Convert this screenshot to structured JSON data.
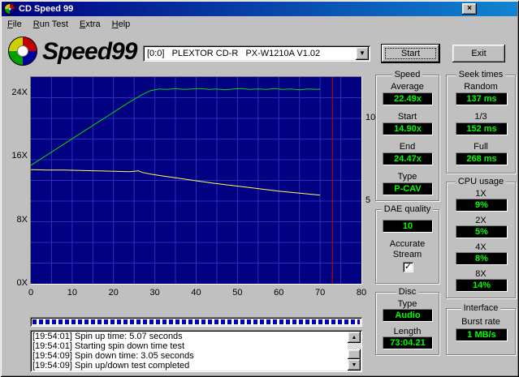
{
  "window": {
    "title": "CD Speed 99",
    "close_glyph": "×"
  },
  "menu": {
    "items": [
      "File",
      "Run Test",
      "Extra",
      "Help"
    ]
  },
  "toolbar": {
    "logo_text": "Speed99",
    "drive_selector": {
      "value": "[0:0]   PLEXTOR CD-R   PX-W1210A V1.02",
      "dropdown_glyph": "▼"
    },
    "start_button": "Start",
    "exit_button": "Exit"
  },
  "colors": {
    "chart_bg": "#000080",
    "chart_grid": "#2d2dc4",
    "end_marker": "#cc0000",
    "lcd_text": "#00ff00",
    "lcd_bg": "#000000",
    "titlebar_start": "#000080",
    "titlebar_end": "#1084d0"
  },
  "chart_data": {
    "type": "line",
    "x": {
      "lim": [
        0,
        80
      ],
      "ticks": [
        0,
        10,
        20,
        30,
        40,
        50,
        60,
        70,
        80
      ],
      "grid_step": 5
    },
    "left_axis": {
      "lim": [
        0,
        26
      ],
      "ticks": [
        {
          "v": 24,
          "label": "24X"
        },
        {
          "v": 16,
          "label": "16X"
        },
        {
          "v": 8,
          "label": "8X"
        },
        {
          "v": 0,
          "label": "0X"
        }
      ]
    },
    "right_axis": {
      "lim": [
        0,
        12.5
      ],
      "ticks": [
        {
          "v": 10,
          "label": "10"
        },
        {
          "v": 5,
          "label": "5"
        }
      ]
    },
    "grid_divisions_y": 10,
    "end_marker_x": 73,
    "series": [
      {
        "name": "read_speed",
        "color": "#00dc00",
        "points": [
          [
            0,
            14.9
          ],
          [
            3,
            15.9
          ],
          [
            6,
            16.9
          ],
          [
            9,
            17.9
          ],
          [
            12,
            18.9
          ],
          [
            15,
            19.9
          ],
          [
            18,
            20.9
          ],
          [
            21,
            21.9
          ],
          [
            24,
            22.9
          ],
          [
            27,
            23.8
          ],
          [
            29,
            24.3
          ],
          [
            31,
            24.5
          ],
          [
            33,
            24.45
          ],
          [
            35,
            24.55
          ],
          [
            37,
            24.45
          ],
          [
            39,
            24.5
          ],
          [
            41,
            24.55
          ],
          [
            43,
            24.45
          ],
          [
            45,
            24.5
          ],
          [
            47,
            24.4
          ],
          [
            49,
            24.5
          ],
          [
            51,
            24.55
          ],
          [
            53,
            24.45
          ],
          [
            55,
            24.5
          ],
          [
            57,
            24.45
          ],
          [
            59,
            24.55
          ],
          [
            61,
            24.45
          ],
          [
            63,
            24.5
          ],
          [
            65,
            24.4
          ],
          [
            67,
            24.5
          ],
          [
            69,
            24.45
          ],
          [
            70,
            24.47
          ]
        ]
      },
      {
        "name": "rotation_speed",
        "color": "#ffff55",
        "points": [
          [
            0,
            14.35
          ],
          [
            4,
            14.3
          ],
          [
            8,
            14.3
          ],
          [
            12,
            14.25
          ],
          [
            16,
            14.2
          ],
          [
            20,
            14.15
          ],
          [
            24,
            14.1
          ],
          [
            26,
            14.2
          ],
          [
            27,
            14.0
          ],
          [
            29,
            13.8
          ],
          [
            32,
            13.55
          ],
          [
            36,
            13.25
          ],
          [
            40,
            12.95
          ],
          [
            44,
            12.65
          ],
          [
            48,
            12.4
          ],
          [
            52,
            12.15
          ],
          [
            56,
            11.9
          ],
          [
            60,
            11.65
          ],
          [
            64,
            11.45
          ],
          [
            68,
            11.25
          ],
          [
            70,
            11.15
          ]
        ]
      }
    ]
  },
  "panels": {
    "speed": {
      "title": "Speed",
      "rows": [
        {
          "label": "Average",
          "value": "22.49x"
        },
        {
          "label": "Start",
          "value": "14.90x"
        },
        {
          "label": "End",
          "value": "24.47x"
        },
        {
          "label": "Type",
          "value": "P-CAV"
        }
      ]
    },
    "seek_times": {
      "title": "Seek times",
      "rows": [
        {
          "label": "Random",
          "value": "137 ms"
        },
        {
          "label": "1/3",
          "value": "152 ms"
        },
        {
          "label": "Full",
          "value": "268 ms"
        }
      ]
    },
    "cpu_usage": {
      "title": "CPU usage",
      "rows": [
        {
          "label": "1X",
          "value": "9%"
        },
        {
          "label": "2X",
          "value": "5%"
        },
        {
          "label": "4X",
          "value": "8%"
        },
        {
          "label": "8X",
          "value": "14%"
        }
      ]
    },
    "dae_quality": {
      "title": "DAE quality",
      "value": "10",
      "accurate_stream_label": "Accurate Stream",
      "checkbox_checked": true,
      "checkbox_glyph": "✓"
    },
    "disc": {
      "title": "Disc",
      "rows": [
        {
          "label": "Type",
          "value": "Audio"
        },
        {
          "label": "Length",
          "value": "73:04.21"
        }
      ]
    },
    "interface": {
      "title": "Interface",
      "rows": [
        {
          "label": "Burst rate",
          "value": "1 MB/s"
        }
      ]
    }
  },
  "log": {
    "lines": [
      "[19:54:01]  Spin up time: 5.07 seconds",
      "[19:54:01]  Starting spin down time test",
      "[19:54:09]  Spin down time: 3.05 seconds",
      "[19:54:09]  Spin up/down test completed"
    ],
    "scroll_up_glyph": "▲",
    "scroll_down_glyph": "▼"
  }
}
